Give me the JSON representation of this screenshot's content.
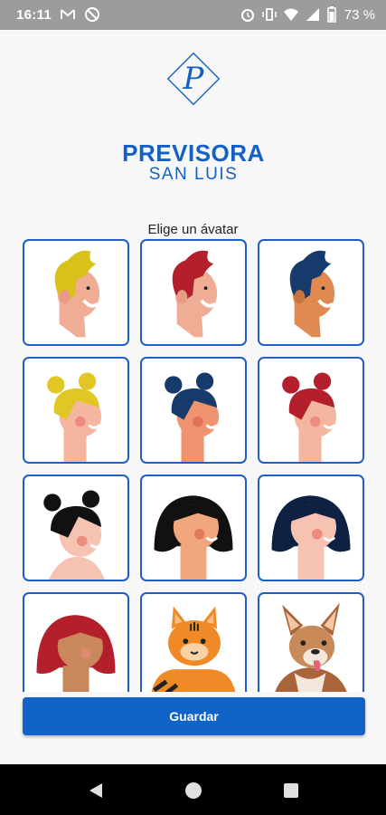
{
  "status_bar": {
    "time": "16:11",
    "battery_percent": "73 %",
    "left_icons": [
      "gmail-icon",
      "dnd-icon"
    ],
    "right_icons": [
      "alarm-icon",
      "vibrate-icon",
      "wifi-icon",
      "signal-icon",
      "battery-icon"
    ]
  },
  "logo": {
    "monogram": "P",
    "brand_name": "PREVISORA",
    "brand_sub": "SAN LUIS",
    "color": "#1460c4"
  },
  "avatar_picker": {
    "prompt": "Elige un ávatar",
    "avatars": [
      {
        "name": "avatar-man-yellow-hair",
        "hair": "#d9c11a",
        "skin": "#f0ad96"
      },
      {
        "name": "avatar-man-red-hair",
        "hair": "#b3202c",
        "skin": "#f0ad96"
      },
      {
        "name": "avatar-man-navy-hair",
        "hair": "#163a6b",
        "skin": "#e08a52"
      },
      {
        "name": "avatar-woman-yellow-buns",
        "hair": "#e2c625",
        "skin": "#f4b6a0"
      },
      {
        "name": "avatar-woman-navy-buns",
        "hair": "#163a6b",
        "skin": "#ef946f"
      },
      {
        "name": "avatar-woman-red-buns",
        "hair": "#b3202c",
        "skin": "#f4b6a0"
      },
      {
        "name": "avatar-woman-black-buns",
        "hair": "#111111",
        "skin": "#f6c3b3"
      },
      {
        "name": "avatar-woman-black-bob",
        "hair": "#111111",
        "skin": "#f1a67e"
      },
      {
        "name": "avatar-woman-navy-bob",
        "hair": "#0f2142",
        "skin": "#f6c3b3"
      },
      {
        "name": "avatar-woman-red-bob",
        "hair": "#b3202c",
        "skin": "#c9875c"
      },
      {
        "name": "avatar-tiger-cat",
        "hair": "#f08a26",
        "skin": "#f6b062"
      },
      {
        "name": "avatar-dog",
        "hair": "#a9643a",
        "skin": "#c98a5a"
      }
    ]
  },
  "actions": {
    "save_label": "Guardar",
    "button_color": "#1163c7"
  },
  "nav_bar": {
    "buttons": [
      "back-icon",
      "home-icon",
      "recents-icon"
    ]
  }
}
